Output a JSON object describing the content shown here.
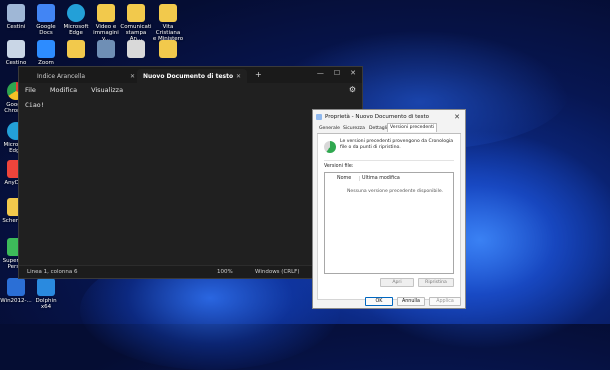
{
  "desktop_icons": [
    {
      "label": "Cestini",
      "icon": "trash-icon",
      "color": "#9fb7d6"
    },
    {
      "label": "Google Docs",
      "icon": "google-docs-icon",
      "color": "#4285f4"
    },
    {
      "label": "Microsoft\nEdge",
      "icon": "edge-icon",
      "color": "#23a0d8"
    },
    {
      "label": "Video e\nimmagini v...",
      "icon": "folder-icon",
      "color": "#f2c94c"
    },
    {
      "label": "Comunicati\nstampa An...",
      "icon": "folder-icon",
      "color": "#f2c94c"
    },
    {
      "label": "Vita Cristiana\ne Ministero",
      "icon": "folder-icon",
      "color": "#f2c94c"
    },
    {
      "label": "Cestino",
      "icon": "recycle-bin-icon",
      "color": "#c9d6e6"
    },
    {
      "label": "Zoom",
      "icon": "zoom-icon",
      "color": "#2d8cff"
    },
    {
      "label": "Google\nChrom...",
      "icon": "chrome-icon",
      "color": "#e34133"
    },
    {
      "label": "Microsoft\nEdge",
      "icon": "edge-icon",
      "color": "#23a0d8"
    },
    {
      "label": "AnyDe...",
      "icon": "anydesk-icon",
      "color": "#ef443b"
    },
    {
      "label": "Scheme...",
      "icon": "folder-icon",
      "color": "#f2c94c"
    },
    {
      "label": "Super A...\nPers...",
      "icon": "app-icon",
      "color": "#3dbb5a"
    },
    {
      "label": "Win2012-...",
      "icon": "app-icon",
      "color": "#2b6fd6"
    },
    {
      "label": "Dolphin x64",
      "icon": "dolphin-icon",
      "color": "#2a8adf"
    }
  ],
  "notepad": {
    "tab_inactive": "Indice Arancella",
    "tab_active": "Nuovo Documento di testo",
    "menu": [
      "File",
      "Modifica",
      "Visualizza"
    ],
    "content": "Ciao!",
    "status": {
      "position": "Linea 1, colonna 6",
      "zoom": "100%",
      "encoding": "Windows (CRLF)"
    }
  },
  "dialog": {
    "title": "Proprietà - Nuovo Documento di testo",
    "tabs": [
      "Generale",
      "Sicurezza",
      "Dettagli",
      "Versioni precedenti"
    ],
    "info": "Le versioni precedenti provengono da Cronologia file o da punti di ripristino.",
    "versions_label": "Versioni file:",
    "columns": [
      "Nome",
      "Ultima modifica"
    ],
    "empty_text": "Nessuna versione precedente disponibile.",
    "open_btn": "Apri",
    "restore_btn": "Ripristina",
    "ok": "OK",
    "cancel": "Annulla",
    "apply": "Applica"
  }
}
